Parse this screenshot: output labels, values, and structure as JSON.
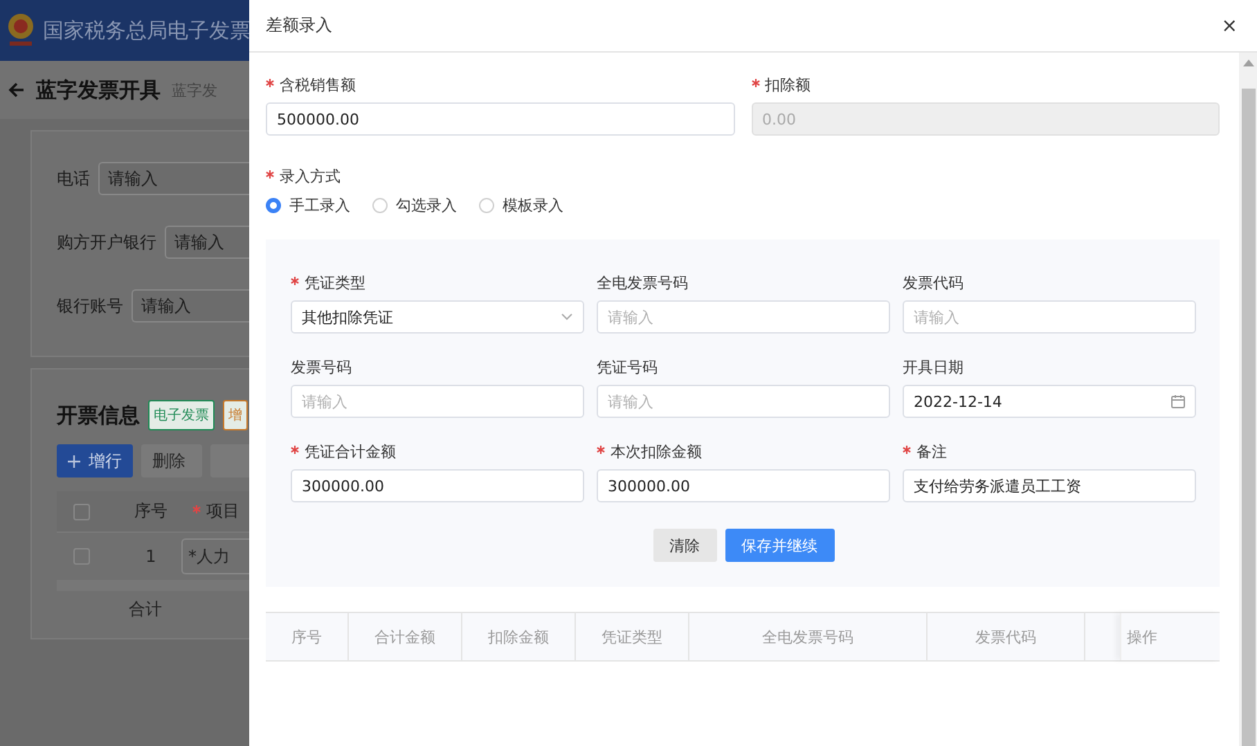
{
  "background_page": {
    "header_title": "国家税务总局电子发票",
    "page_title": "蓝字发票开具",
    "breadcrumb": "蓝字发",
    "buyer_fields": [
      {
        "label": "电话",
        "placeholder": "请输入"
      },
      {
        "label": "购方开户银行",
        "placeholder": "请输入"
      },
      {
        "label": "银行账号",
        "placeholder": "请输入"
      }
    ],
    "invoice_section": {
      "title": "开票信息",
      "tags": [
        {
          "label": "电子发票",
          "color": "#1f8a55"
        },
        {
          "label": "增",
          "color": "#c8792a"
        }
      ],
      "buttons": [
        {
          "label": "增行",
          "kind": "primary"
        },
        {
          "label": "删除",
          "kind": "plain"
        },
        {
          "kind": "plain"
        }
      ],
      "table": {
        "header_checked": false,
        "columns": [
          {
            "label": "序号",
            "required": false
          },
          {
            "label": "项目",
            "required": true
          }
        ],
        "rows": [
          {
            "checked": false,
            "index": "1",
            "item": "*人力"
          }
        ],
        "total_label": "合计"
      }
    }
  },
  "drawer": {
    "title": "差额录入",
    "close": "×",
    "amount_fields": [
      {
        "label": "含税销售额",
        "required": true,
        "value": "500000.00",
        "disabled": false
      },
      {
        "label": "扣除额",
        "required": true,
        "value": "0.00",
        "disabled": true
      }
    ],
    "entry_mode": {
      "label": "录入方式",
      "required": true,
      "options": [
        {
          "label": "手工录入",
          "selected": true
        },
        {
          "label": "勾选录入",
          "selected": false
        },
        {
          "label": "模板录入",
          "selected": false
        }
      ]
    },
    "voucher_fields": [
      {
        "kind": "select",
        "label": "凭证类型",
        "required": true,
        "value": "其他扣除凭证"
      },
      {
        "kind": "input",
        "label": "全电发票号码",
        "required": false,
        "placeholder": "请输入"
      },
      {
        "kind": "input",
        "label": "发票代码",
        "required": false,
        "placeholder": "请输入"
      },
      {
        "kind": "input",
        "label": "发票号码",
        "required": false,
        "placeholder": "请输入"
      },
      {
        "kind": "input",
        "label": "凭证号码",
        "required": false,
        "placeholder": "请输入"
      },
      {
        "kind": "date",
        "label": "开具日期",
        "required": false,
        "value": "2022-12-14"
      },
      {
        "kind": "input",
        "label": "凭证合计金额",
        "required": true,
        "value": "300000.00"
      },
      {
        "kind": "input",
        "label": "本次扣除金额",
        "required": true,
        "value": "300000.00"
      },
      {
        "kind": "input",
        "label": "备注",
        "required": true,
        "value": "支付给劳务派遣员工工资"
      }
    ],
    "form_buttons": [
      {
        "label": "清除",
        "kind": "plain"
      },
      {
        "label": "保存并继续",
        "kind": "primary"
      }
    ],
    "table_columns": [
      "序号",
      "合计金额",
      "扣除金额",
      "凭证类型",
      "全电发票号码",
      "发票代码"
    ],
    "action_column": "操作"
  }
}
